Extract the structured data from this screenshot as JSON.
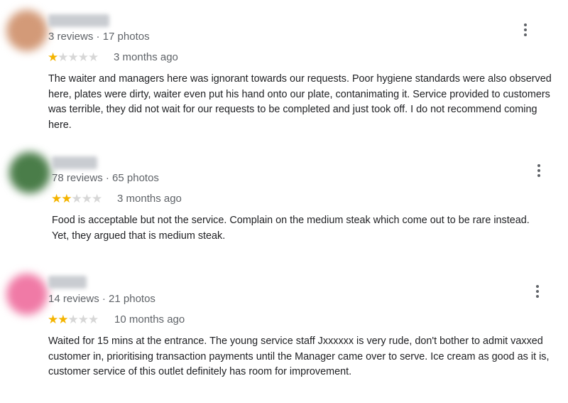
{
  "reviews": [
    {
      "reviews_count": "3 reviews",
      "photos_count": "17 photos",
      "rating": 1,
      "time": "3 months ago",
      "text": "The waiter and managers here was ignorant towards our requests. Poor hygiene standards were also observed here, plates were dirty, waiter even put his hand onto our plate, contanimating it. Service provided to customers was terrible, they did not wait for our requests to be completed and just took off. I do not recommend coming here.",
      "avatar_color": "#d39a78"
    },
    {
      "reviews_count": "78 reviews",
      "photos_count": "65 photos",
      "rating": 2,
      "time": "3 months ago",
      "text": "Food is acceptable but not the service. Complain on the medium steak which come out to be rare instead. Yet, they argued that is medium steak.",
      "avatar_color": "#4a7d49"
    },
    {
      "reviews_count": "14 reviews",
      "photos_count": "21 photos",
      "rating": 2,
      "time": "10 months ago",
      "text": "Waited for 15 mins at the entrance. The young service staff Jxxxxxx is very rude, don't bother to admit vaxxed customer in, prioritising transaction payments until the Manager came over to serve. Ice cream as good as it is, customer service of this outlet definitely has room for improvement.",
      "avatar_color": "#f07aa6"
    }
  ],
  "meta_separator": " · ",
  "star_max": 5,
  "icons": {
    "star": "star-icon",
    "more": "more-vert-icon"
  },
  "colors": {
    "star_filled": "#f4b400",
    "star_empty": "#d7d7d7",
    "meta_text": "#5f6368",
    "body_text": "#202124"
  }
}
